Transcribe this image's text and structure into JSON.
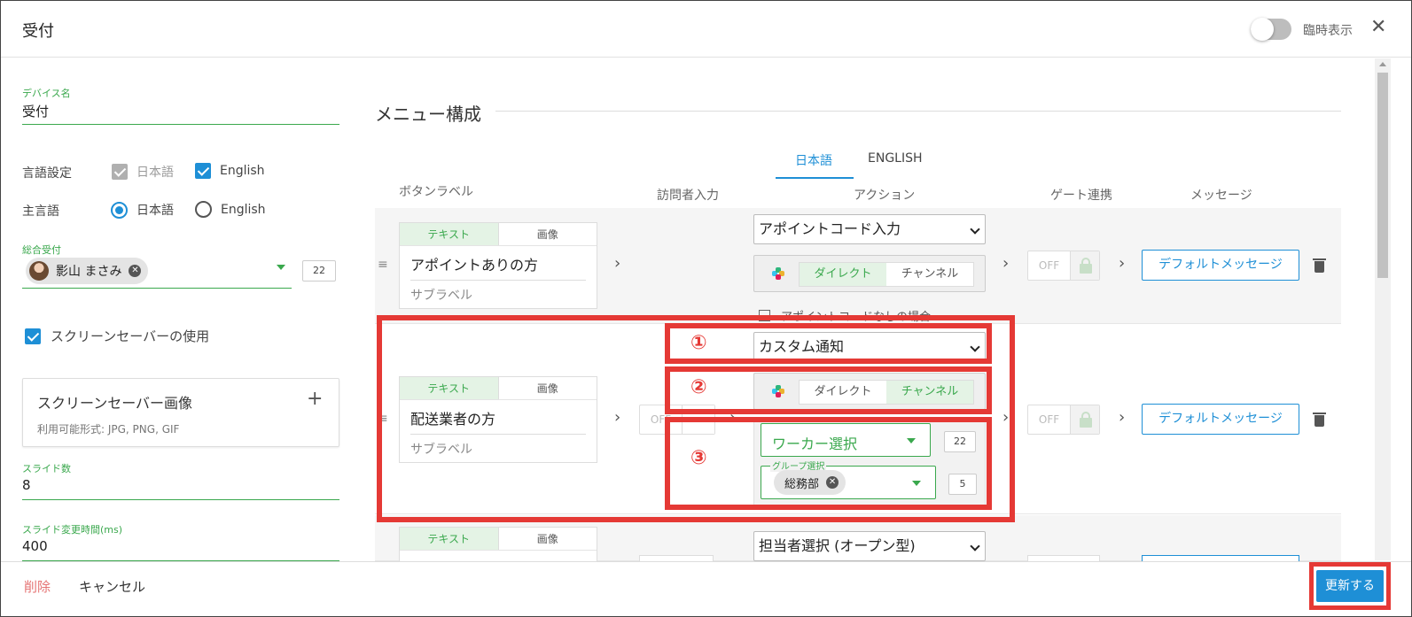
{
  "header": {
    "title": "受付",
    "toggle_label": "臨時表示",
    "close_glyph": "✕"
  },
  "left": {
    "device_name_label": "デバイス名",
    "device_name_value": "受付",
    "language_label": "言語設定",
    "language_options": [
      "日本語",
      "English"
    ],
    "main_language_label": "主言語",
    "main_language_options": [
      "日本語",
      "English"
    ],
    "general_reception_label": "総合受付",
    "general_reception_chip": "影山 まさみ",
    "general_reception_count": "22",
    "screensaver_checkbox": "スクリーンセーバーの使用",
    "screensaver_image_title": "スクリーンセーバー画像",
    "screensaver_image_formats": "利用可能形式: JPG, PNG, GIF",
    "add_glyph": "+",
    "slide_count_label": "スライド数",
    "slide_count_value": "8",
    "slide_interval_label": "スライド変更時間(ms)",
    "slide_interval_value": "400"
  },
  "main": {
    "section_title": "メニュー構成",
    "tabs": [
      "日本語",
      "ENGLISH"
    ],
    "columns": [
      "ボタンラベル",
      "訪問者入力",
      "アクション",
      "ゲート連携",
      "メッセージ"
    ],
    "segment": {
      "text": "テキスト",
      "image": "画像"
    },
    "sublabel": "サブラベル",
    "direct": "ダイレクト",
    "channel": "チャンネル",
    "off": "OFF",
    "default_message": "デフォルトメッセージ",
    "chevron": "›",
    "handle": "≡",
    "rows": [
      {
        "label": "アポイントありの方",
        "action": "アポイントコード入力",
        "note": "アポイントコードなしの場合"
      },
      {
        "label": "配送業者の方",
        "action": "カスタム通知",
        "worker_select": "ワーカー選択",
        "worker_count": "22",
        "group_label": "グループ選択",
        "group_chip": "総務部",
        "group_count": "5"
      },
      {
        "action": "担当者選択 (オープン型)"
      }
    ],
    "annotations": [
      "①",
      "②",
      "③"
    ]
  },
  "footer": {
    "delete": "削除",
    "cancel": "キャンセル",
    "update": "更新する"
  },
  "colors": {
    "accent_blue": "#1e8fd6",
    "accent_green": "#3aa84d",
    "annotation_red": "#e53935",
    "delete_red": "#e57373"
  }
}
